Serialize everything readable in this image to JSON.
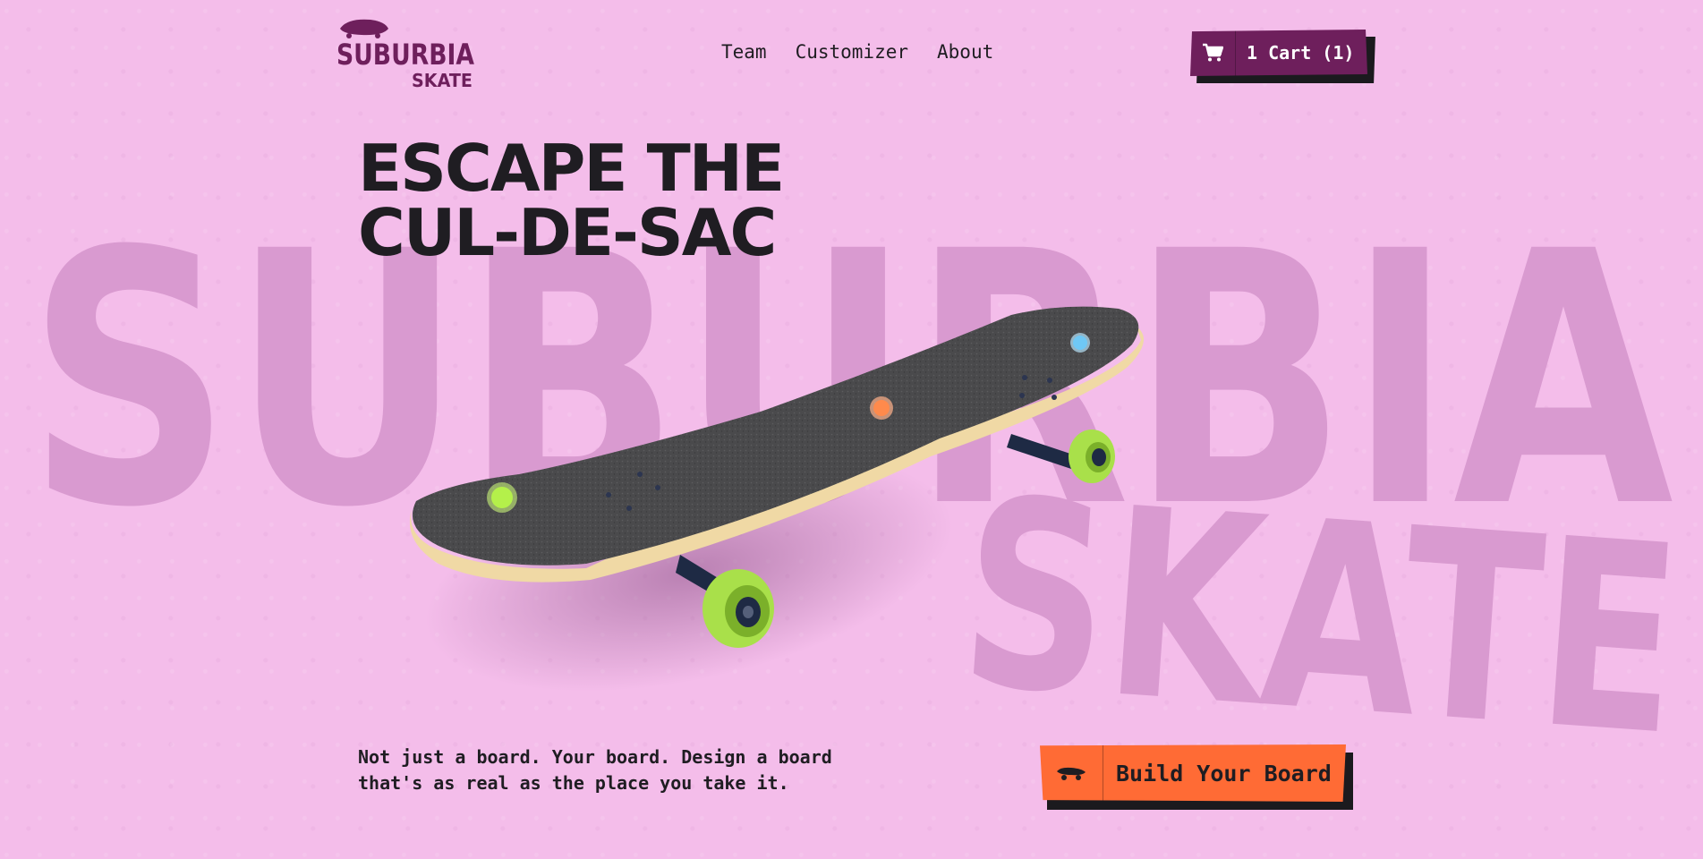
{
  "brand": {
    "logo_line1": "SUBURBIA",
    "logo_line2": "SKATE",
    "logo_icon": "skateboard-icon",
    "background_word_line1": "SUBURBIA",
    "background_word_line2": "SKATE"
  },
  "nav": {
    "items": [
      {
        "label": "Team"
      },
      {
        "label": "Customizer"
      },
      {
        "label": "About"
      }
    ]
  },
  "cart": {
    "icon": "cart-icon",
    "label": "1 Cart (1)"
  },
  "hero": {
    "headline_line1": "ESCAPE THE",
    "headline_line2": "CUL-DE-SAC",
    "tagline": "Not just a board. Your board. Design a board that's as real as the place you take it.",
    "cta_label": "Build Your Board",
    "cta_icon": "skateboard-icon"
  },
  "board": {
    "hotspots": [
      {
        "name": "hotspot-wheel",
        "color": "#b4f04a"
      },
      {
        "name": "hotspot-deck",
        "color": "#ff8a4c"
      },
      {
        "name": "hotspot-truck",
        "color": "#6fc8f5"
      }
    ]
  },
  "colors": {
    "background": "#f4bdea",
    "brand_purple": "#6e1f5c",
    "cta_orange": "#ff6b35",
    "text_dark": "#1f1d22",
    "wheel_green": "#b4f04a"
  }
}
